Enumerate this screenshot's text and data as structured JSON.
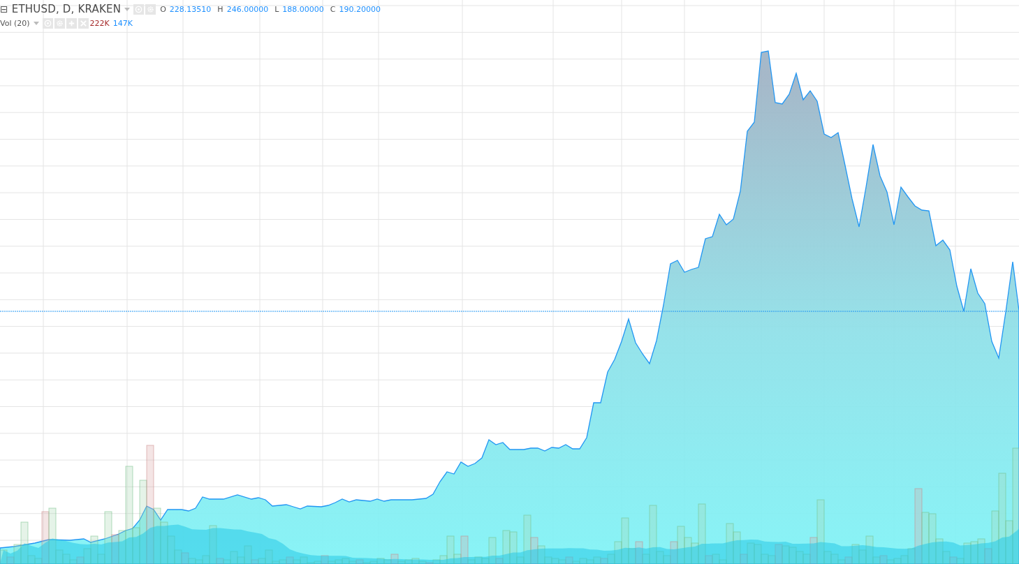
{
  "legend": {
    "collapse_symbol": "⊟",
    "title": "ETHUSD, D, KRAKEN",
    "ohlc": [
      {
        "label": "O",
        "value": "228.13510"
      },
      {
        "label": "H",
        "value": "246.00000"
      },
      {
        "label": "L",
        "value": "188.00000"
      },
      {
        "label": "C",
        "value": "190.20000"
      }
    ]
  },
  "volume_legend": {
    "title": "Vol (20)",
    "values": [
      {
        "value": "222K",
        "color": "#a52a2a"
      },
      {
        "value": "147K",
        "color": "#1e90ff"
      }
    ]
  }
}
